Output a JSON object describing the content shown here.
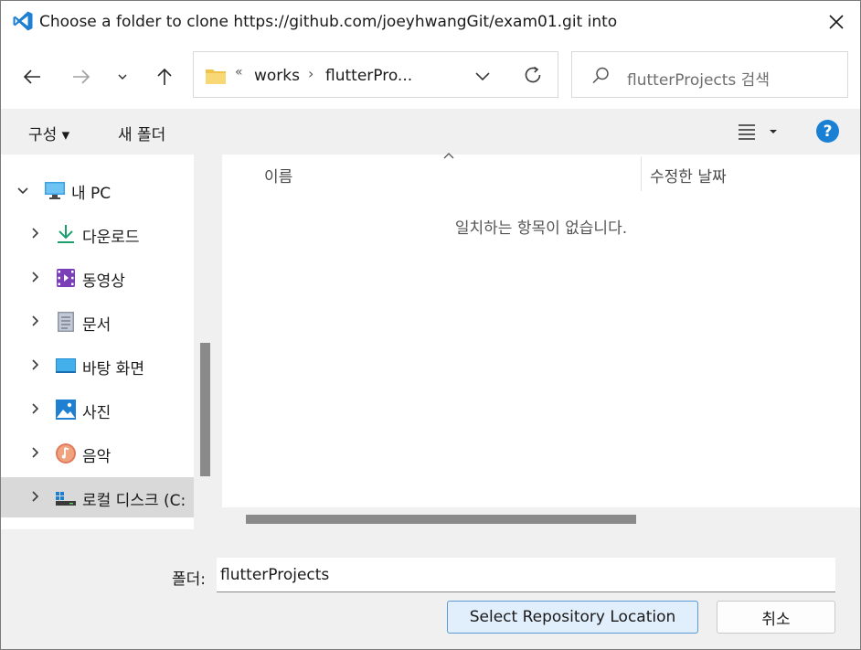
{
  "window": {
    "title": "Choose a folder to clone https://github.com/joeyhwangGit/exam01.git into"
  },
  "address_bar": {
    "overflow_chevron": "«",
    "segments": [
      "works",
      "flutterPro..."
    ],
    "separator": "›"
  },
  "search": {
    "placeholder": "flutterProjects 검색"
  },
  "command_bar": {
    "organize": "구성 ▾",
    "new_folder": "새 폴더"
  },
  "nav_pane": {
    "items": [
      {
        "label": "내 PC",
        "icon": "pc-icon",
        "expanded": true
      },
      {
        "label": "다운로드",
        "icon": "download-icon"
      },
      {
        "label": "동영상",
        "icon": "video-icon"
      },
      {
        "label": "문서",
        "icon": "document-icon"
      },
      {
        "label": "바탕 화면",
        "icon": "desktop-icon"
      },
      {
        "label": "사진",
        "icon": "pictures-icon"
      },
      {
        "label": "음악",
        "icon": "music-icon"
      },
      {
        "label": "로컬 디스크 (C:",
        "icon": "drive-icon",
        "selected": true
      }
    ]
  },
  "file_list": {
    "columns": [
      "이름",
      "수정한 날짜"
    ],
    "empty_message": "일치하는 항목이 없습니다."
  },
  "footer": {
    "folder_label": "폴더:",
    "folder_value": "flutterProjects",
    "select_button": "Select Repository Location",
    "cancel_button": "취소"
  },
  "colors": {
    "accent": "#1a80d4",
    "selection": "#d9d9d9",
    "primary_button_bg": "#e1eefb"
  }
}
